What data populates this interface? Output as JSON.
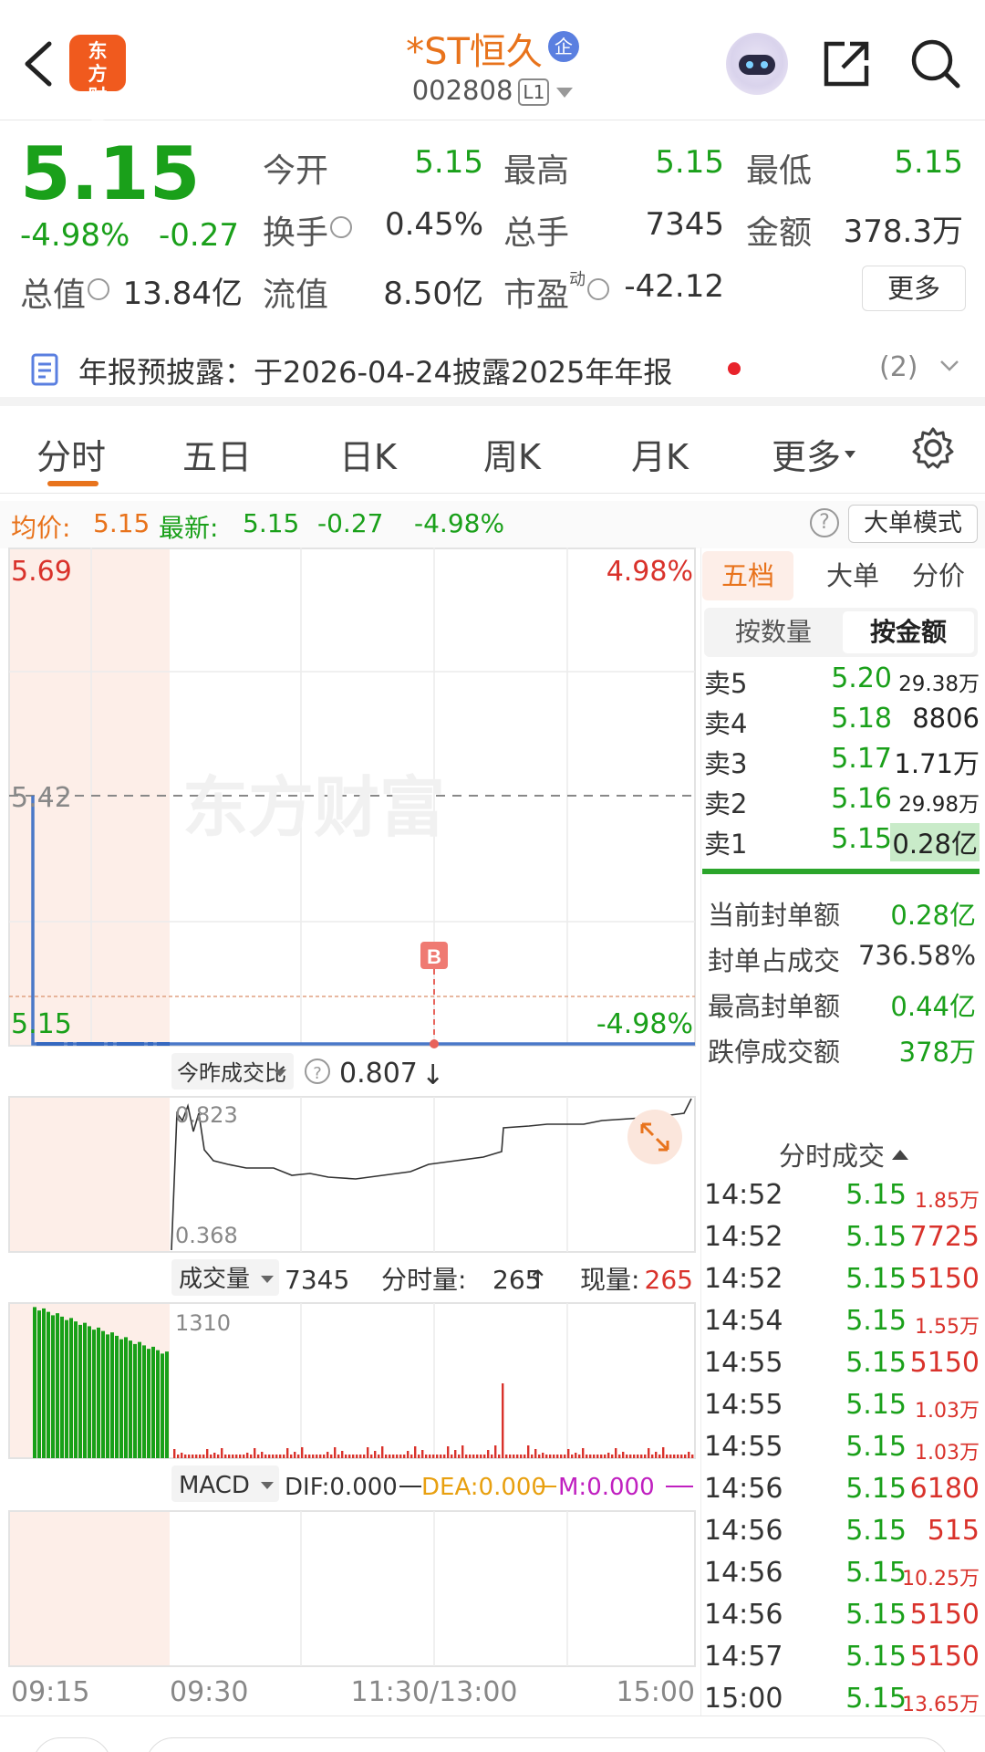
{
  "header": {
    "logo_text": "东方财富",
    "title": "*ST恒久",
    "badge": "企",
    "code": "002808",
    "level": "L1"
  },
  "quote": {
    "price": "5.15",
    "change_pct": "-4.98%",
    "change": "-0.27",
    "open_label": "今开",
    "open": "5.15",
    "high_label": "最高",
    "high": "5.15",
    "low_label": "最低",
    "low": "5.15",
    "turnover_label": "换手",
    "turnover": "0.45%",
    "volume_label": "总手",
    "volume": "7345",
    "amount_label": "金额",
    "amount": "378.3万",
    "mktcap_label": "总值",
    "mktcap": "13.84亿",
    "float_label": "流值",
    "float": "8.50亿",
    "pe_label": "市盈",
    "pe_sup": "动",
    "pe": "-42.12",
    "more_label": "更多"
  },
  "notice": {
    "text": "年报预披露：于2026-04-24披露2025年年报",
    "count": "(2)"
  },
  "tabs": [
    "分时",
    "五日",
    "日K",
    "周K",
    "月K",
    "更多"
  ],
  "infobar": {
    "avg_label": "均价:",
    "avg": "5.15",
    "last_label": "最新:",
    "last": "5.15",
    "chg": "-0.27",
    "chg_pct": "-4.98%",
    "mode_button": "大单模式"
  },
  "chart": {
    "top_price": "5.69",
    "top_pct": "4.98%",
    "mid_price": "5.42",
    "bottom_price": "5.15",
    "bottom_pct": "-4.98%",
    "watermark": "东方财富",
    "marker": "B",
    "ratio_label": "今昨成交比",
    "ratio": "0.807",
    "ratio_max": "0.823",
    "ratio_min": "0.368",
    "vol_label": "成交量",
    "vol": "7345",
    "minute_vol_label": "分时量:",
    "minute_vol": "265",
    "cur_vol_label": "现量:",
    "cur_vol": "265",
    "vol_max": "1310",
    "macd_label": "MACD",
    "dif": "DIF:0.000",
    "dea": "DEA:0.000",
    "m": "M:0.000",
    "times": [
      "09:15",
      "09:30",
      "11:30/13:00",
      "15:00"
    ]
  },
  "side": {
    "tabs": [
      "五档",
      "大单",
      "分价"
    ],
    "subtabs": [
      "按数量",
      "按金额"
    ],
    "sells": [
      {
        "label": "卖5",
        "price": "5.20",
        "amt": "29.38万"
      },
      {
        "label": "卖4",
        "price": "5.18",
        "amt": "8806"
      },
      {
        "label": "卖3",
        "price": "5.17",
        "amt": "1.71万"
      },
      {
        "label": "卖2",
        "price": "5.16",
        "amt": "29.98万"
      },
      {
        "label": "卖1",
        "price": "5.15",
        "amt": "0.28亿"
      }
    ],
    "stats": [
      {
        "label": "当前封单额",
        "value": "0.28亿"
      },
      {
        "label": "封单占成交",
        "value": "736.58%"
      },
      {
        "label": "最高封单额",
        "value": "0.44亿"
      },
      {
        "label": "跌停成交额",
        "value": "378万"
      }
    ],
    "trades_title": "分时成交",
    "trades": [
      {
        "t": "14:52",
        "p": "5.15",
        "v": "1.85万"
      },
      {
        "t": "14:52",
        "p": "5.15",
        "v": "7725"
      },
      {
        "t": "14:52",
        "p": "5.15",
        "v": "5150"
      },
      {
        "t": "14:54",
        "p": "5.15",
        "v": "1.55万"
      },
      {
        "t": "14:55",
        "p": "5.15",
        "v": "5150"
      },
      {
        "t": "14:55",
        "p": "5.15",
        "v": "1.03万"
      },
      {
        "t": "14:55",
        "p": "5.15",
        "v": "1.03万"
      },
      {
        "t": "14:56",
        "p": "5.15",
        "v": "6180"
      },
      {
        "t": "14:56",
        "p": "5.15",
        "v": "515"
      },
      {
        "t": "14:56",
        "p": "5.15",
        "v": "10.25万"
      },
      {
        "t": "14:56",
        "p": "5.15",
        "v": "5150"
      },
      {
        "t": "14:57",
        "p": "5.15",
        "v": "5150"
      },
      {
        "t": "15:00",
        "p": "5.15",
        "v": "13.65万"
      }
    ]
  },
  "colors": {
    "up": "#d9322b",
    "down": "#1aa01a",
    "accent": "#e8731c"
  }
}
